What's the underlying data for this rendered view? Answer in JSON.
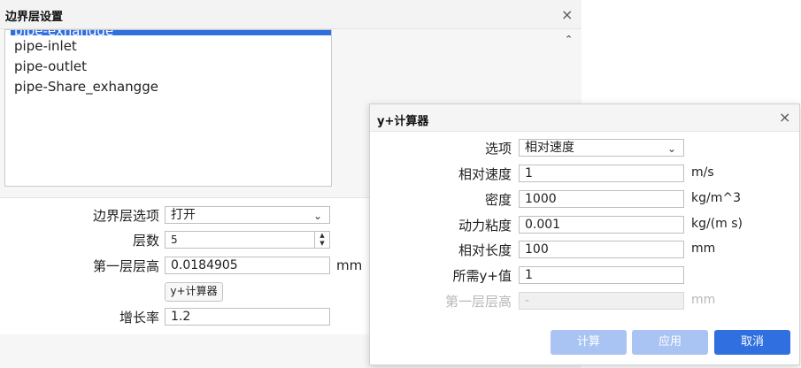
{
  "boundary_dialog": {
    "title": "边界层设置",
    "close_glyph": "×",
    "list_items": [
      "pipe-exhangge",
      "pipe-inlet",
      "pipe-outlet",
      "pipe-Share_exhangge"
    ],
    "scroll_glyph": "⌃",
    "options_label": "边界层选项",
    "options_value": "打开",
    "layers_label": "层数",
    "layers_value": "5",
    "first_height_label": "第一层层高",
    "first_height_value": "0.0184905",
    "first_height_unit": "mm",
    "yplus_button": "y+计算器",
    "growth_label": "增长率",
    "growth_value": "1.2"
  },
  "yplus_dialog": {
    "title": "y+计算器",
    "close_glyph": "×",
    "option_label": "选项",
    "option_value": "相对速度",
    "velocity_label": "相对速度",
    "velocity_value": "1",
    "velocity_unit": "m/s",
    "density_label": "密度",
    "density_value": "1000",
    "density_unit": "kg/m^3",
    "viscosity_label": "动力粘度",
    "viscosity_value": "0.001",
    "viscosity_unit": "kg/(m s)",
    "length_label": "相对长度",
    "length_value": "100",
    "length_unit": "mm",
    "target_label": "所需y+值",
    "target_value": "1",
    "first_height_label": "第一层层高",
    "first_height_value": "-",
    "first_height_unit": "mm",
    "calc_button": "计算",
    "apply_button": "应用",
    "cancel_button": "取消"
  },
  "colors": {
    "accent": "#2f6fe0",
    "accent_disabled": "#a9c4f3"
  }
}
